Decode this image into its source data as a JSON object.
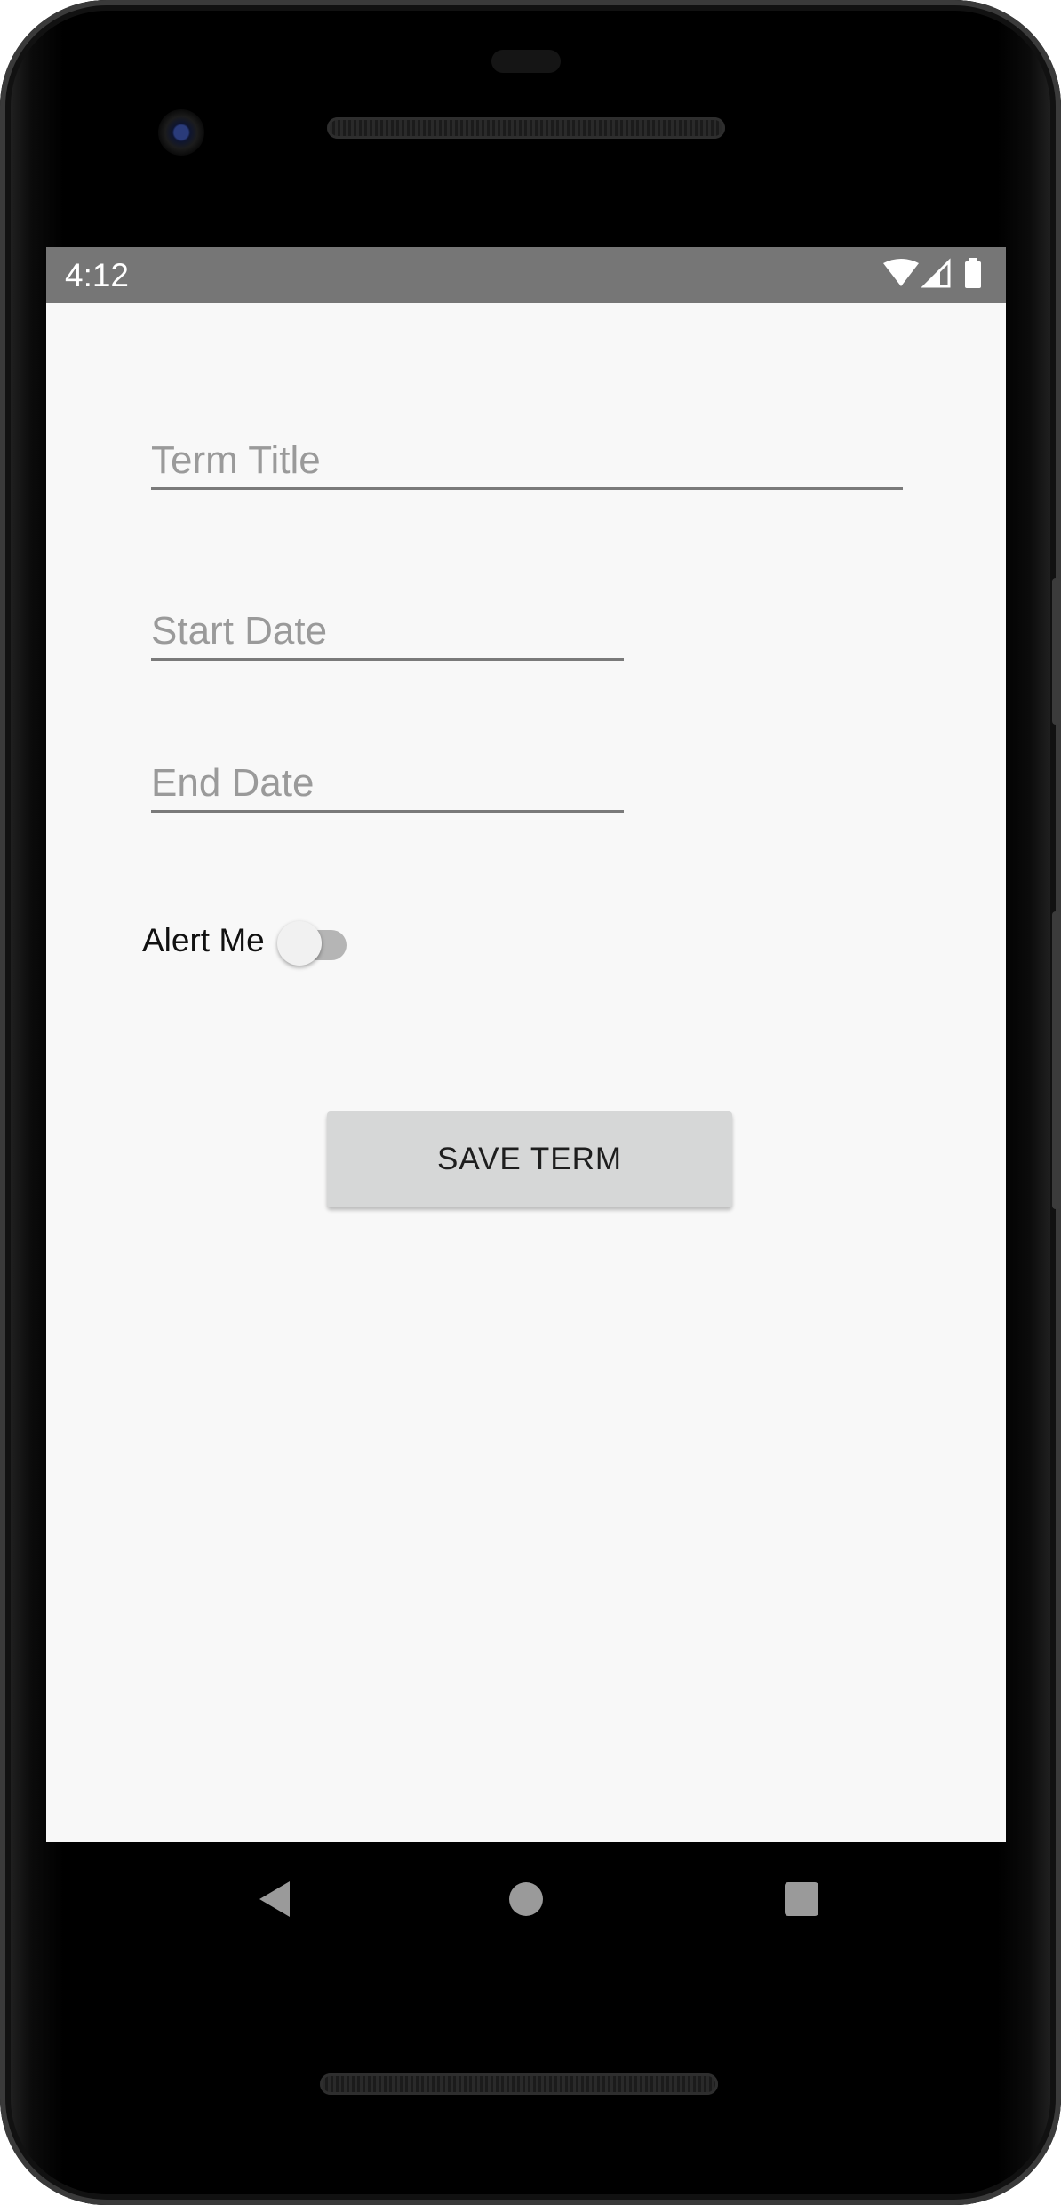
{
  "status_bar": {
    "time": "4:12",
    "icons": [
      "wifi-icon",
      "cell-signal-icon",
      "battery-icon"
    ]
  },
  "form": {
    "term_title": {
      "value": "",
      "placeholder": "Term Title"
    },
    "start_date": {
      "value": "",
      "placeholder": "Start Date"
    },
    "end_date": {
      "value": "",
      "placeholder": "End Date"
    },
    "alert": {
      "label": "Alert Me",
      "checked": false
    },
    "save_label": "SAVE TERM"
  },
  "nav_bar": {
    "icons": [
      "back-icon",
      "home-icon",
      "recents-icon"
    ]
  },
  "colors": {
    "status_bar_bg": "#767676",
    "screen_bg": "#f8f8f8",
    "button_bg": "#d6d7d7",
    "underline": "#7a7a7a",
    "placeholder": "#9a9a9a"
  }
}
